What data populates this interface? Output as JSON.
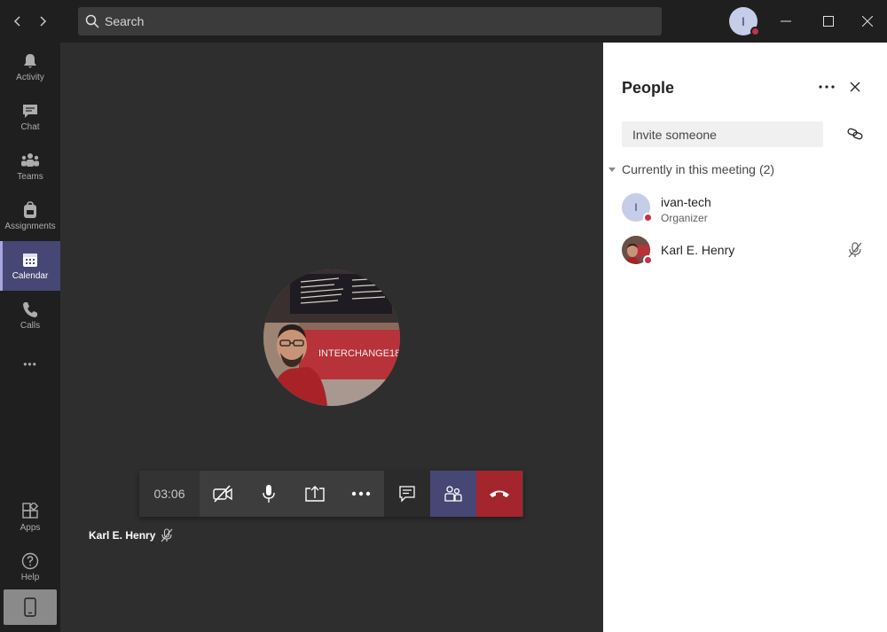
{
  "titlebar": {
    "search_placeholder": "Search",
    "user_initial": "I",
    "status_color": "#c4314b"
  },
  "rail": {
    "items": [
      {
        "label": "Activity",
        "icon": "bell-icon"
      },
      {
        "label": "Chat",
        "icon": "chat-icon"
      },
      {
        "label": "Teams",
        "icon": "teams-icon"
      },
      {
        "label": "Assignments",
        "icon": "backpack-icon"
      },
      {
        "label": "Calendar",
        "icon": "calendar-icon",
        "active": true
      },
      {
        "label": "Calls",
        "icon": "phone-icon"
      }
    ],
    "more_label": "•••",
    "bottom_items": [
      {
        "label": "Apps",
        "icon": "apps-icon"
      },
      {
        "label": "Help",
        "icon": "help-icon"
      }
    ]
  },
  "meeting": {
    "timer": "03:06",
    "participant_name": "Karl E. Henry",
    "banner_text": "INTERCHANGE18",
    "controls": [
      "camera-off",
      "microphone",
      "share-screen",
      "more-options",
      "show-conversation",
      "show-participants",
      "hang-up"
    ],
    "accent_color": "#464775",
    "hangup_color": "#a4262c"
  },
  "people_panel": {
    "title": "People",
    "invite_placeholder": "Invite someone",
    "section_label": "Currently in this meeting",
    "section_count": "(2)",
    "people": [
      {
        "name": "ivan-tech",
        "role": "Organizer",
        "initial": "I",
        "muted": false
      },
      {
        "name": "Karl E. Henry",
        "role": "",
        "initial": "",
        "muted": true
      }
    ]
  }
}
